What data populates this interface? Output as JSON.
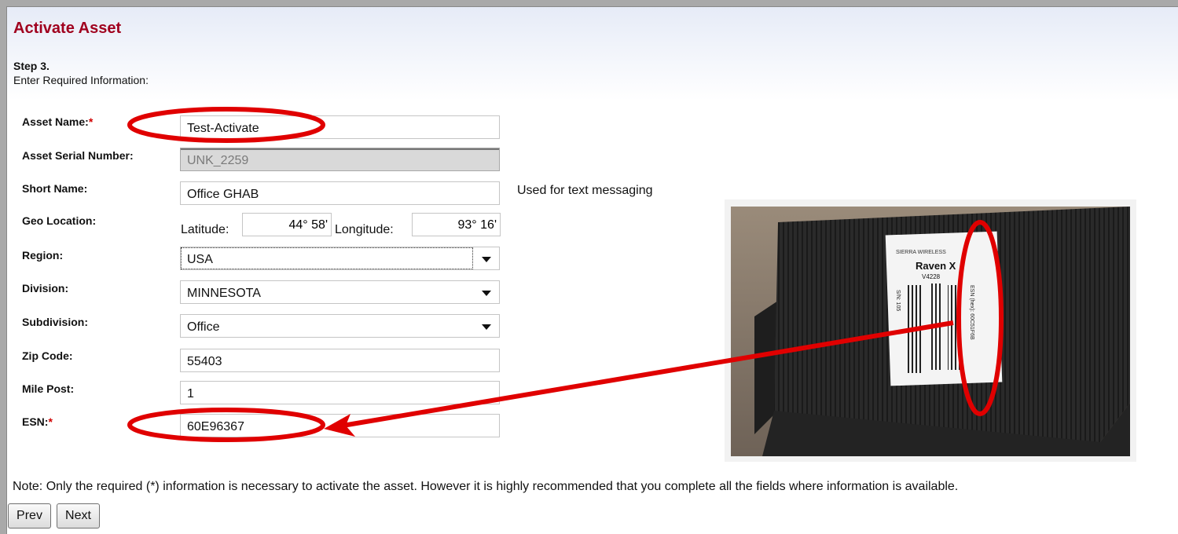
{
  "page": {
    "title": "Activate Asset",
    "step": "Step 3.",
    "instruction": "Enter Required Information:"
  },
  "form": {
    "asset_name": {
      "label": "Asset Name:",
      "required": "*",
      "value": "Test-Activate"
    },
    "asset_serial": {
      "label": "Asset Serial Number:",
      "value": "UNK_2259"
    },
    "short_name": {
      "label": "Short Name:",
      "value": "Office GHAB",
      "hint": "Used for text messaging"
    },
    "geo_location": {
      "label": "Geo Location:",
      "latitude_label": "Latitude:",
      "latitude": "44° 58'",
      "longitude_label": "Longitude:",
      "longitude": "93° 16'"
    },
    "region": {
      "label": "Region:",
      "value": "USA"
    },
    "division": {
      "label": "Division:",
      "value": "MINNESOTA"
    },
    "subdivision": {
      "label": "Subdivision:",
      "value": "Office"
    },
    "zip_code": {
      "label": "Zip Code:",
      "value": "55403"
    },
    "mile_post": {
      "label": "Mile Post:",
      "value": "1"
    },
    "esn": {
      "label": "ESN:",
      "required": "*",
      "value": "60E96367"
    }
  },
  "note": "Note: Only the required (*) information is necessary to activate the asset. However it is highly recommended that you complete all the fields where information is available.",
  "buttons": {
    "prev": "Prev",
    "next": "Next"
  },
  "device_photo": {
    "brand": "SIERRA WIRELESS",
    "model": "Raven X",
    "model_code": "V4228",
    "sn_label": "S/N: 105",
    "esn_hex_label": "ESN (hex): 60C51F6B",
    "colors": {
      "annotation": "#e00000",
      "device": "#2b2b2b",
      "label": "#f4f4f4"
    }
  },
  "colors": {
    "title": "#a0001e",
    "required": "#d00000"
  }
}
